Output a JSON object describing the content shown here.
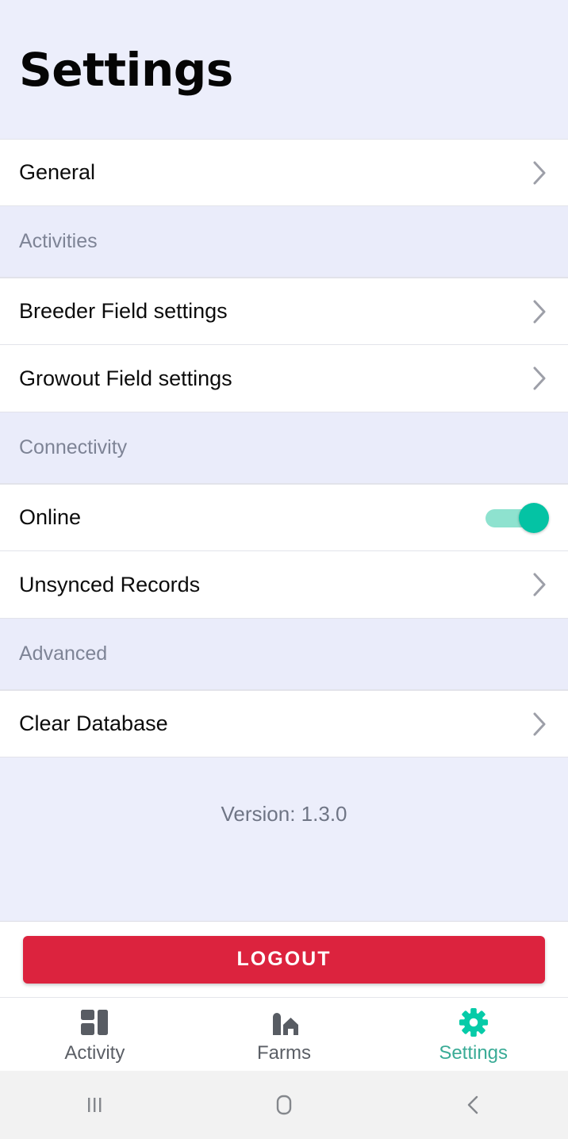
{
  "header": {
    "title": "Settings"
  },
  "list": [
    {
      "kind": "row",
      "label": "General",
      "accessory": "chevron-right-icon"
    },
    {
      "kind": "section",
      "label": "Activities"
    },
    {
      "kind": "row",
      "label": "Breeder Field settings",
      "accessory": "chevron-right-icon"
    },
    {
      "kind": "row",
      "label": "Growout Field settings",
      "accessory": "chevron-right-icon"
    },
    {
      "kind": "section",
      "label": "Connectivity"
    },
    {
      "kind": "row",
      "label": "Online",
      "accessory": "toggle-switch",
      "toggle_state": "on"
    },
    {
      "kind": "row",
      "label": "Unsynced Records",
      "accessory": "chevron-right-icon"
    },
    {
      "kind": "section",
      "label": "Advanced"
    },
    {
      "kind": "row",
      "label": "Clear Database",
      "accessory": "chevron-right-icon"
    }
  ],
  "rows": {
    "general": "General",
    "breeder_field_settings": "Breeder Field settings",
    "growout_field_settings": "Growout Field settings",
    "online": "Online",
    "unsynced_records": "Unsynced Records",
    "clear_database": "Clear Database"
  },
  "sections": {
    "activities": "Activities",
    "connectivity": "Connectivity",
    "advanced": "Advanced"
  },
  "footer": {
    "version": "Version: 1.3.0"
  },
  "logout": {
    "label": "LOGOUT"
  },
  "tabs": [
    {
      "label": "Activity",
      "icon": "dashboard-icon",
      "active": false
    },
    {
      "label": "Farms",
      "icon": "barn-icon",
      "active": false
    },
    {
      "label": "Settings",
      "icon": "gear-icon",
      "active": true
    }
  ],
  "tab_labels": {
    "activity": "Activity",
    "farms": "Farms",
    "settings": "Settings"
  },
  "system_nav": {
    "recents": "recents-icon",
    "home": "home-icon",
    "back": "back-icon"
  },
  "colors": {
    "accent_teal": "#04c3a4",
    "tab_active": "#3aab96",
    "danger_red": "#dc233e",
    "band_lavender": "#eaecfa",
    "page_lavender": "#eceefb",
    "section_text": "#7e8496"
  }
}
